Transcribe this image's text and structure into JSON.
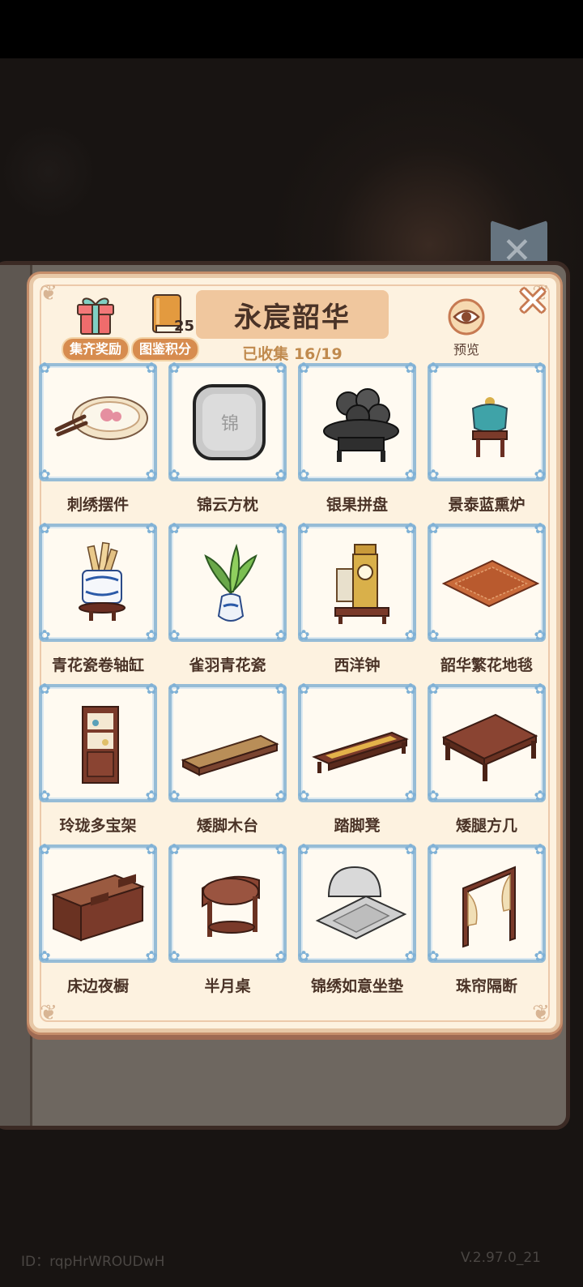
{
  "album": {
    "title": "永宸韶华",
    "collected": "已收集 16/19",
    "reward_label": "集齐奖励",
    "points_label": "图鉴积分",
    "points_value": "25",
    "preview_label": "预览"
  },
  "items": [
    {
      "name": "刺绣摆件",
      "icon": "embroidery-ornament"
    },
    {
      "name": "锦云方枕",
      "icon": "square-pillow"
    },
    {
      "name": "银果拼盘",
      "icon": "fruit-platter"
    },
    {
      "name": "景泰蓝熏炉",
      "icon": "cloisonne-censer"
    },
    {
      "name": "青花瓷卷轴缸",
      "icon": "scroll-vat"
    },
    {
      "name": "雀羽青花瓷",
      "icon": "feather-vase"
    },
    {
      "name": "西洋钟",
      "icon": "western-clock"
    },
    {
      "name": "韶华繁花地毯",
      "icon": "floral-carpet"
    },
    {
      "name": "玲珑多宝架",
      "icon": "curio-shelf"
    },
    {
      "name": "矮脚木台",
      "icon": "low-platform"
    },
    {
      "name": "踏脚凳",
      "icon": "footstool"
    },
    {
      "name": "矮腿方几",
      "icon": "square-table"
    },
    {
      "name": "床边夜橱",
      "icon": "nightstand"
    },
    {
      "name": "半月桌",
      "icon": "half-moon-table"
    },
    {
      "name": "锦绣如意坐垫",
      "icon": "ruyi-cushion"
    },
    {
      "name": "珠帘隔断",
      "icon": "bead-curtain"
    }
  ],
  "footer": {
    "id_text": "ID：rqpHrWROUDwH",
    "version": "V.2.97.0_21"
  },
  "colors": {
    "accent": "#d78c4f",
    "panel_bg": "#fdf2e0",
    "frame_border": "#96bcd6",
    "text": "#4a3327"
  }
}
